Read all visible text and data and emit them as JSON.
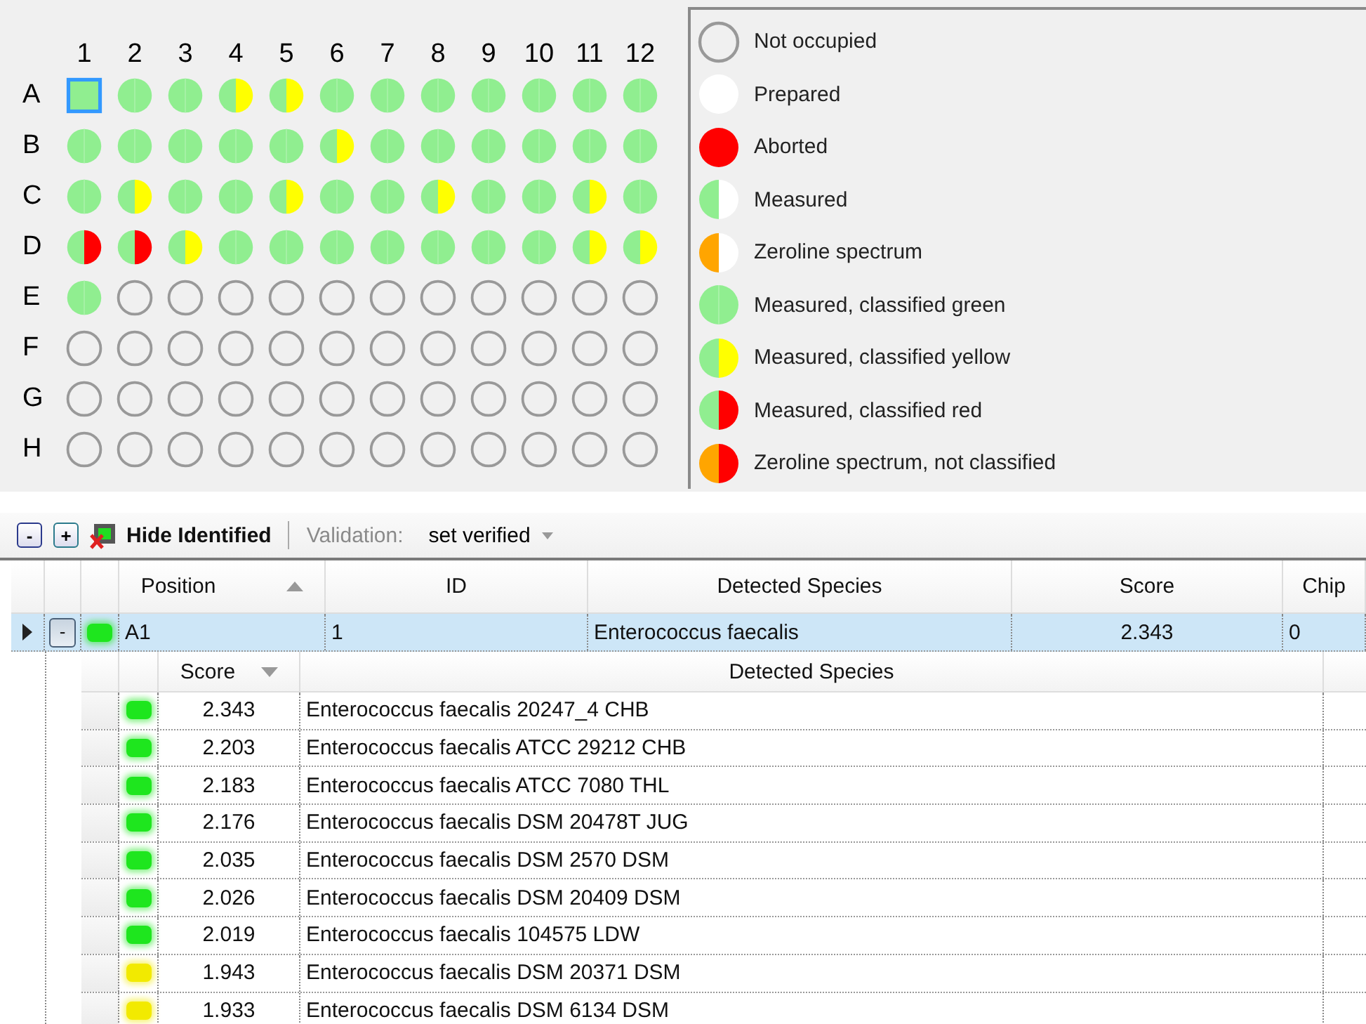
{
  "plate": {
    "columns": [
      "1",
      "2",
      "3",
      "4",
      "5",
      "6",
      "7",
      "8",
      "9",
      "10",
      "11",
      "12"
    ],
    "rows": [
      {
        "label": "A",
        "wells": [
          {
            "kind": "green",
            "selected": true
          },
          {
            "kind": "green",
            "selected": false
          },
          {
            "kind": "green",
            "selected": false
          },
          {
            "kind": "yellow",
            "selected": false
          },
          {
            "kind": "yellow",
            "selected": false
          },
          {
            "kind": "green",
            "selected": false
          },
          {
            "kind": "green",
            "selected": false
          },
          {
            "kind": "green",
            "selected": false
          },
          {
            "kind": "green",
            "selected": false
          },
          {
            "kind": "green",
            "selected": false
          },
          {
            "kind": "green",
            "selected": false
          },
          {
            "kind": "green",
            "selected": false
          }
        ]
      },
      {
        "label": "B",
        "wells": [
          {
            "kind": "green",
            "selected": false
          },
          {
            "kind": "green",
            "selected": false
          },
          {
            "kind": "green",
            "selected": false
          },
          {
            "kind": "green",
            "selected": false
          },
          {
            "kind": "green",
            "selected": false
          },
          {
            "kind": "yellow",
            "selected": false
          },
          {
            "kind": "green",
            "selected": false
          },
          {
            "kind": "green",
            "selected": false
          },
          {
            "kind": "green",
            "selected": false
          },
          {
            "kind": "green",
            "selected": false
          },
          {
            "kind": "green",
            "selected": false
          },
          {
            "kind": "green",
            "selected": false
          }
        ]
      },
      {
        "label": "C",
        "wells": [
          {
            "kind": "green",
            "selected": false
          },
          {
            "kind": "yellow",
            "selected": false
          },
          {
            "kind": "green",
            "selected": false
          },
          {
            "kind": "green",
            "selected": false
          },
          {
            "kind": "yellow",
            "selected": false
          },
          {
            "kind": "green",
            "selected": false
          },
          {
            "kind": "green",
            "selected": false
          },
          {
            "kind": "yellow",
            "selected": false
          },
          {
            "kind": "green",
            "selected": false
          },
          {
            "kind": "green",
            "selected": false
          },
          {
            "kind": "yellow",
            "selected": false
          },
          {
            "kind": "green",
            "selected": false
          }
        ]
      },
      {
        "label": "D",
        "wells": [
          {
            "kind": "red",
            "selected": false
          },
          {
            "kind": "red",
            "selected": false
          },
          {
            "kind": "yellow",
            "selected": false
          },
          {
            "kind": "green",
            "selected": false
          },
          {
            "kind": "green",
            "selected": false
          },
          {
            "kind": "green",
            "selected": false
          },
          {
            "kind": "green",
            "selected": false
          },
          {
            "kind": "green",
            "selected": false
          },
          {
            "kind": "green",
            "selected": false
          },
          {
            "kind": "green",
            "selected": false
          },
          {
            "kind": "yellow",
            "selected": false
          },
          {
            "kind": "yellow",
            "selected": false
          }
        ]
      },
      {
        "label": "E",
        "wells": [
          {
            "kind": "green",
            "selected": false
          },
          {
            "kind": "empty",
            "selected": false
          },
          {
            "kind": "empty",
            "selected": false
          },
          {
            "kind": "empty",
            "selected": false
          },
          {
            "kind": "empty",
            "selected": false
          },
          {
            "kind": "empty",
            "selected": false
          },
          {
            "kind": "empty",
            "selected": false
          },
          {
            "kind": "empty",
            "selected": false
          },
          {
            "kind": "empty",
            "selected": false
          },
          {
            "kind": "empty",
            "selected": false
          },
          {
            "kind": "empty",
            "selected": false
          },
          {
            "kind": "empty",
            "selected": false
          }
        ]
      },
      {
        "label": "F",
        "wells": [
          {
            "kind": "empty",
            "selected": false
          },
          {
            "kind": "empty",
            "selected": false
          },
          {
            "kind": "empty",
            "selected": false
          },
          {
            "kind": "empty",
            "selected": false
          },
          {
            "kind": "empty",
            "selected": false
          },
          {
            "kind": "empty",
            "selected": false
          },
          {
            "kind": "empty",
            "selected": false
          },
          {
            "kind": "empty",
            "selected": false
          },
          {
            "kind": "empty",
            "selected": false
          },
          {
            "kind": "empty",
            "selected": false
          },
          {
            "kind": "empty",
            "selected": false
          },
          {
            "kind": "empty",
            "selected": false
          }
        ]
      },
      {
        "label": "G",
        "wells": [
          {
            "kind": "empty",
            "selected": false
          },
          {
            "kind": "empty",
            "selected": false
          },
          {
            "kind": "empty",
            "selected": false
          },
          {
            "kind": "empty",
            "selected": false
          },
          {
            "kind": "empty",
            "selected": false
          },
          {
            "kind": "empty",
            "selected": false
          },
          {
            "kind": "empty",
            "selected": false
          },
          {
            "kind": "empty",
            "selected": false
          },
          {
            "kind": "empty",
            "selected": false
          },
          {
            "kind": "empty",
            "selected": false
          },
          {
            "kind": "empty",
            "selected": false
          },
          {
            "kind": "empty",
            "selected": false
          }
        ]
      },
      {
        "label": "H",
        "wells": [
          {
            "kind": "empty",
            "selected": false
          },
          {
            "kind": "empty",
            "selected": false
          },
          {
            "kind": "empty",
            "selected": false
          },
          {
            "kind": "empty",
            "selected": false
          },
          {
            "kind": "empty",
            "selected": false
          },
          {
            "kind": "empty",
            "selected": false
          },
          {
            "kind": "empty",
            "selected": false
          },
          {
            "kind": "empty",
            "selected": false
          },
          {
            "kind": "empty",
            "selected": false
          },
          {
            "kind": "empty",
            "selected": false
          },
          {
            "kind": "empty",
            "selected": false
          },
          {
            "kind": "empty",
            "selected": false
          }
        ]
      }
    ]
  },
  "legend": [
    {
      "label": "Not occupied",
      "kind": "empty"
    },
    {
      "label": "Prepared",
      "kind": "prepared"
    },
    {
      "label": "Aborted",
      "kind": "aborted"
    },
    {
      "label": "Measured",
      "kind": "measured"
    },
    {
      "label": "Zeroline spectrum",
      "kind": "zeroline"
    },
    {
      "label": "Measured, classified green",
      "kind": "green"
    },
    {
      "label": "Measured, classified yellow",
      "kind": "yellow"
    },
    {
      "label": "Measured, classified red",
      "kind": "red"
    },
    {
      "label": "Zeroline spectrum, not classified",
      "kind": "zeroline-red"
    }
  ],
  "toolbar": {
    "collapse": "-",
    "expand": "+",
    "hide_identified": "Hide Identified",
    "validation_label": "Validation:",
    "validation_value": "set verified",
    "validation_disabled": true
  },
  "table": {
    "columns": [
      {
        "label": "Position",
        "sorted": true,
        "descending": false
      },
      {
        "label": "ID",
        "sorted": false
      },
      {
        "label": "Detected Species",
        "sorted": false
      },
      {
        "label": "Score",
        "sorted": false
      },
      {
        "label": "Chip",
        "sorted": false
      }
    ],
    "rows": [
      {
        "position": "A1",
        "id": "1",
        "species": "Enterococcus faecalis",
        "score": "2.343",
        "chip": "0",
        "selected": true,
        "expanded": true,
        "toggle": "-",
        "color": "#1ee61e",
        "matches": {
          "columns": [
            {
              "label": "Score",
              "sorted": true,
              "descending": true
            },
            {
              "label": "Detected Species",
              "sorted": false
            }
          ],
          "rows": [
            {
              "score": "2.343",
              "species": "Enterococcus faecalis 20247_4 CHB",
              "color": "#1ee61e"
            },
            {
              "score": "2.203",
              "species": "Enterococcus faecalis ATCC 29212 CHB",
              "color": "#1ee61e"
            },
            {
              "score": "2.183",
              "species": "Enterococcus faecalis ATCC 7080 THL",
              "color": "#1ee61e"
            },
            {
              "score": "2.176",
              "species": "Enterococcus faecalis DSM 20478T JUG",
              "color": "#1ee61e"
            },
            {
              "score": "2.035",
              "species": "Enterococcus faecalis DSM 2570 DSM",
              "color": "#1ee61e"
            },
            {
              "score": "2.026",
              "species": "Enterococcus faecalis DSM 20409 DSM",
              "color": "#1ee61e"
            },
            {
              "score": "2.019",
              "species": "Enterococcus faecalis 104575 LDW",
              "color": "#1ee61e"
            },
            {
              "score": "1.943",
              "species": "Enterococcus faecalis DSM 20371 DSM",
              "color": "#f2ea00"
            },
            {
              "score": "1.933",
              "species": "Enterococcus faecalis DSM 6134 DSM",
              "color": "#f2ea00"
            }
          ]
        }
      }
    ]
  }
}
